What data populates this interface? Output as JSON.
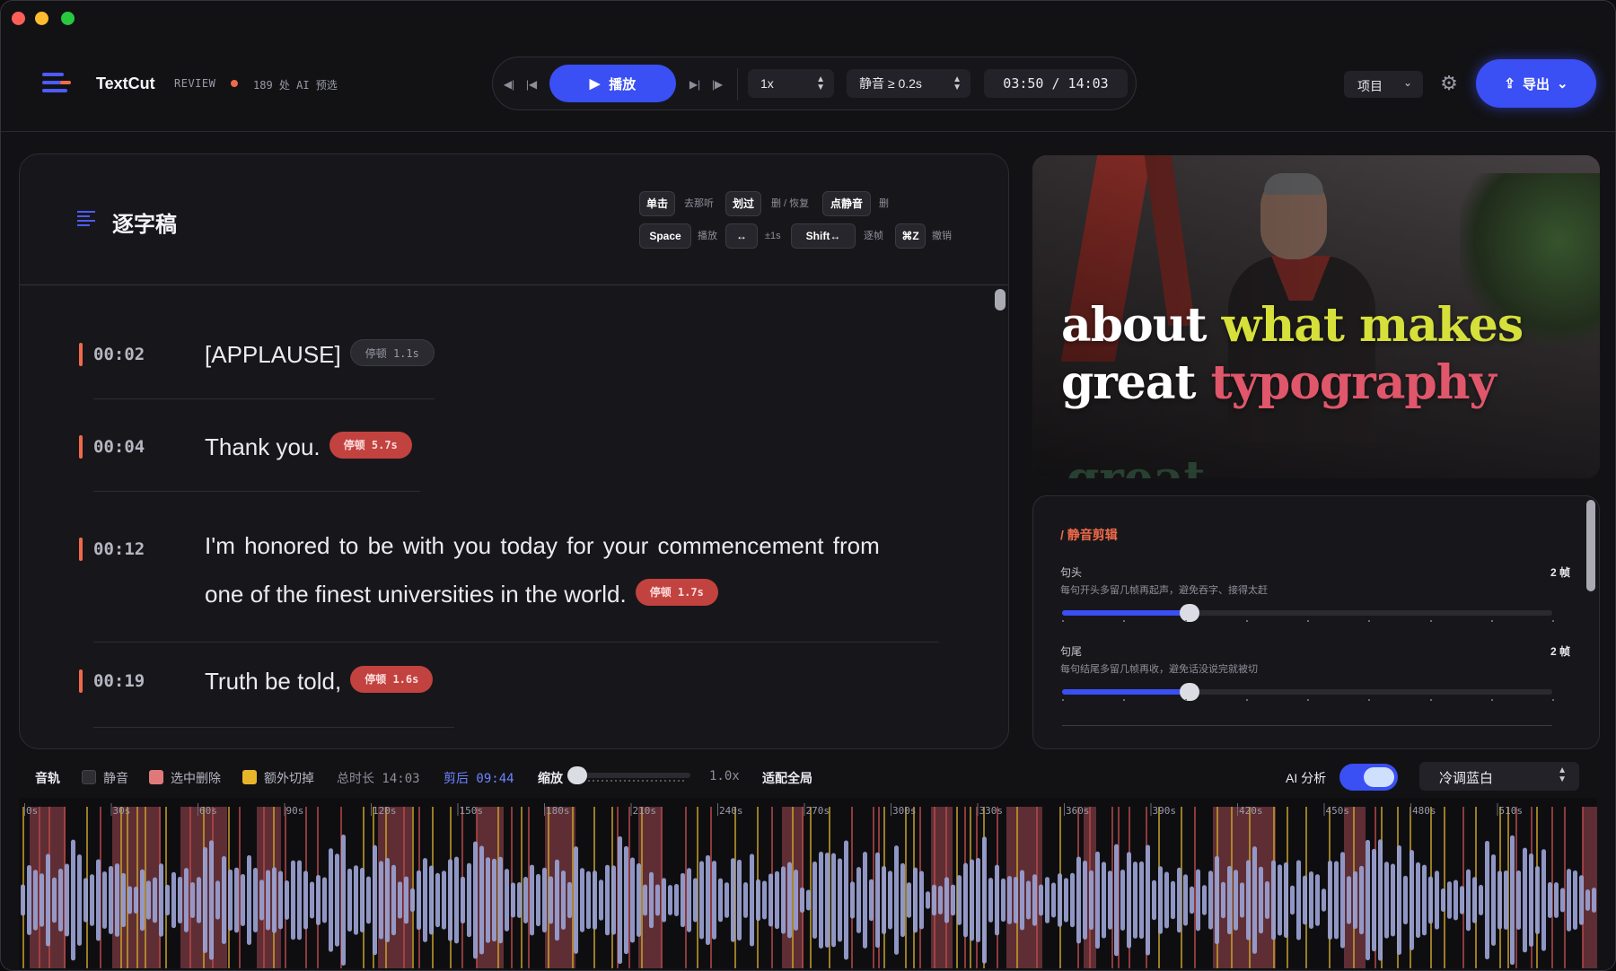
{
  "app": {
    "name": "TextCut",
    "mode": "REVIEW",
    "ai_prefilter": "189 处 AI 预选",
    "status_color": "#ef6a4a",
    "accent_color": "#3a4ff4"
  },
  "transport": {
    "play_label": "播放",
    "speed": "1x",
    "silence_threshold": "静音 ≥ 0.2s",
    "time_display": "03:50 / 14:03"
  },
  "header_right": {
    "project_label": "项目",
    "export_label": "导出"
  },
  "transcript": {
    "title": "逐字稿",
    "shortcuts": [
      {
        "key": "单击",
        "desc": "去那听"
      },
      {
        "key": "划过",
        "desc": "删 / 恢复"
      },
      {
        "key": "点静音",
        "desc": "删"
      },
      {
        "key": "Space",
        "desc": "播放"
      },
      {
        "key": "↔",
        "desc": "±1s"
      },
      {
        "key": "Shift↔",
        "desc": "逐帧"
      },
      {
        "key": "⌘Z",
        "desc": "撤销"
      }
    ],
    "segments": [
      {
        "time": "00:02",
        "text": "[APPLAUSE]",
        "pause": "停顿 1.1s",
        "pause_style": "grey"
      },
      {
        "time": "00:04",
        "text": "Thank you.",
        "pause": "停顿 5.7s",
        "pause_style": "red"
      },
      {
        "time": "00:12",
        "text_line1": "I'm honored to be with you today for your commencement from",
        "text_line2": "one of the finest universities in the world.",
        "pause": "停顿 1.7s",
        "pause_style": "red"
      },
      {
        "time": "00:19",
        "text": "Truth be told,",
        "pause": "停顿 1.6s",
        "pause_style": "red"
      }
    ]
  },
  "video": {
    "caption_words": [
      {
        "text": "about ",
        "color": "#ffffff"
      },
      {
        "text": "what makes",
        "color": "#d6e03a"
      },
      {
        "text": "great ",
        "color": "#ffffff"
      },
      {
        "text": "typography",
        "color": "#e0566a"
      }
    ],
    "ghost_text": "great"
  },
  "silence_panel": {
    "title": "/ 静音剪辑",
    "controls": [
      {
        "label": "句头",
        "desc": "每句开头多留几帧再起声，避免吞字、接得太赶",
        "value": "2 帧",
        "level": 0.26
      },
      {
        "label": "句尾",
        "desc": "每句结尾多留几帧再收，避免话没说完就被切",
        "value": "2 帧",
        "level": 0.26
      }
    ]
  },
  "timeline_bar": {
    "track_label": "音轨",
    "legend": [
      {
        "label": "静音",
        "color": "#2e2e34"
      },
      {
        "label": "选中删除",
        "color": "#e07a7a"
      },
      {
        "label": "额外切掉",
        "color": "#e8b42a"
      }
    ],
    "total": "总时长 14:03",
    "after_cut": "剪后 09:44",
    "zoom_label": "缩放",
    "zoom_value": "1.0x",
    "fit_label": "适配全局",
    "ai_label": "AI 分析",
    "ai_enabled": true,
    "theme": "冷调蓝白"
  },
  "waveform": {
    "time_labels": [
      "0s",
      "30s",
      "60s",
      "90s",
      "120s",
      "150s",
      "180s",
      "210s",
      "240s",
      "270s",
      "300s",
      "330s",
      "360s",
      "390s",
      "420s",
      "450s",
      "480s",
      "510s"
    ],
    "wave_color": "#9aa2d2",
    "delete_color": "#7a3a40",
    "extra_color": "#c9a22a"
  }
}
